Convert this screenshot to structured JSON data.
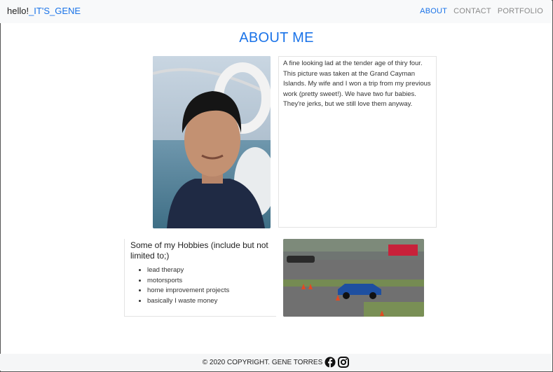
{
  "nav": {
    "brand_hello": "hello!",
    "brand_name": "_IT'S_GENE",
    "links": [
      "ABOUT",
      "CONTACT",
      "PORTFOLIO"
    ]
  },
  "page": {
    "title": "ABOUT ME"
  },
  "about": {
    "text": "A fine looking lad at the tender age of thiry four. This picture was taken at the Grand Cayman Islands. My wife and I won a trip from my previous work (pretty sweet!). We have two fur babies. They're jerks, but we still love them anyway."
  },
  "hobbies": {
    "title": "Some of my Hobbies (include but not limited to;)",
    "items": [
      "lead therapy",
      "motorsports",
      "home improvement projects",
      "basically I waste money"
    ]
  },
  "footer": {
    "copyright": "© 2020 COPYRIGHT. GENE TORRES"
  },
  "colors": {
    "accent": "#1a73e8",
    "nav_bg": "#f8f9fa"
  },
  "icons": [
    "facebook-icon",
    "instagram-icon"
  ]
}
